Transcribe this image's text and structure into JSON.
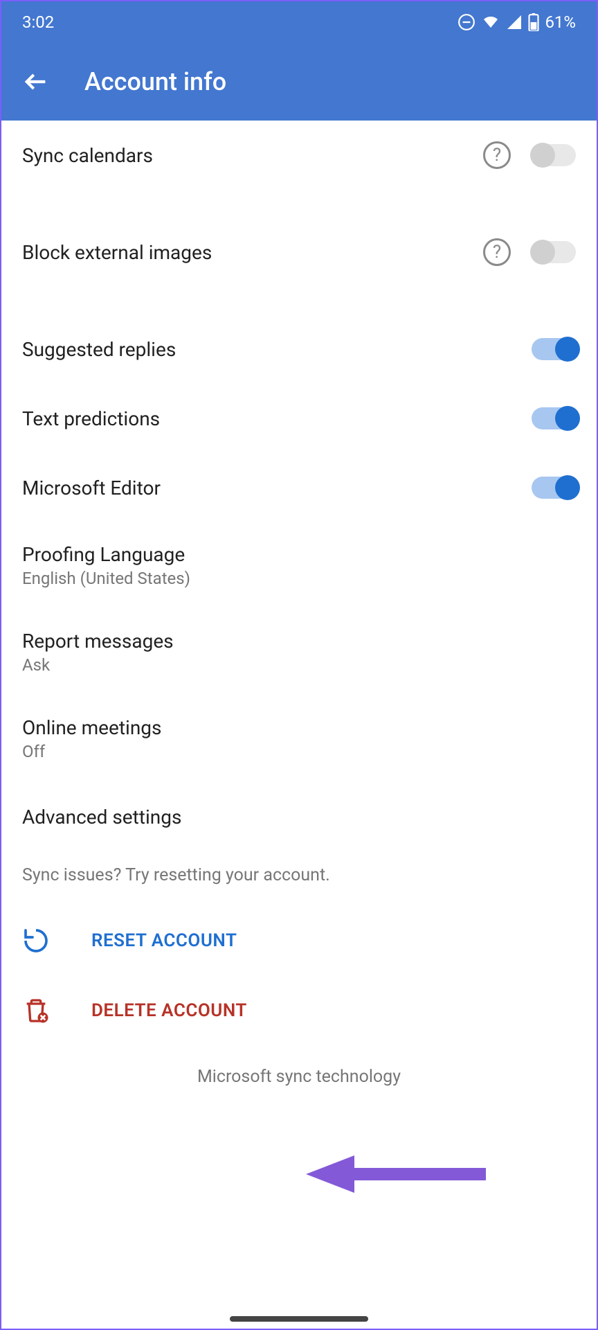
{
  "status": {
    "time": "3:02",
    "battery": "61%"
  },
  "header": {
    "title": "Account info"
  },
  "settings": {
    "sync_calendars": "Sync calendars",
    "block_external_images": "Block external images",
    "suggested_replies": "Suggested replies",
    "text_predictions": "Text predictions",
    "microsoft_editor": "Microsoft Editor",
    "proofing_language": {
      "label": "Proofing Language",
      "value": "English (United States)"
    },
    "report_messages": {
      "label": "Report messages",
      "value": "Ask"
    },
    "online_meetings": {
      "label": "Online meetings",
      "value": "Off"
    },
    "advanced_settings": "Advanced settings"
  },
  "hint": "Sync issues? Try resetting your account.",
  "actions": {
    "reset": "RESET ACCOUNT",
    "delete": "DELETE ACCOUNT"
  },
  "footer": "Microsoft sync technology",
  "colors": {
    "primary": "#4377d0",
    "accent": "#1f6fd0",
    "danger": "#b73227",
    "annotation": "#8359d8"
  }
}
